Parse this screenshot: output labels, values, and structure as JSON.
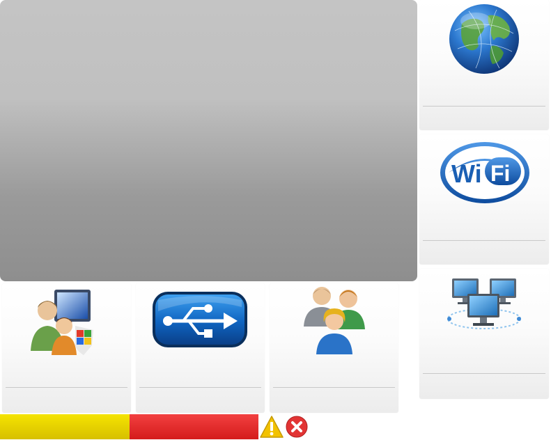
{
  "main_panel": {
    "content": ""
  },
  "tiles": [
    {
      "name": "internet",
      "icon": "globe-icon",
      "label": ""
    },
    {
      "name": "wifi",
      "icon": "wifi-icon",
      "label": "",
      "icon_text_wi": "Wi",
      "icon_text_fi": "Fi"
    },
    {
      "name": "network",
      "icon": "network-computers-icon",
      "label": ""
    },
    {
      "name": "parental-controls",
      "icon": "parental-controls-icon",
      "label": ""
    },
    {
      "name": "usb",
      "icon": "usb-icon",
      "label": ""
    },
    {
      "name": "users",
      "icon": "users-icon",
      "label": ""
    }
  ],
  "status": {
    "segments": [
      {
        "name": "yellow",
        "color": "#e6d300"
      },
      {
        "name": "red",
        "color": "#e52727"
      }
    ],
    "warning_icon": "warning-icon",
    "error_icon": "error-icon"
  },
  "colors": {
    "wifi_blue": "#1a5fb4",
    "usb_blue": "#1170c8",
    "globe_blue": "#1e5aa8"
  }
}
